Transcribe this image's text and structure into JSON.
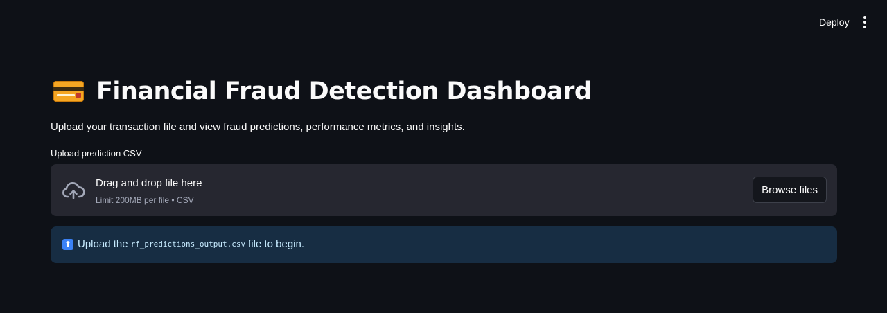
{
  "header": {
    "deploy_label": "Deploy",
    "menu_icon": "more-vertical-icon"
  },
  "page": {
    "title_icon": "credit-card-icon",
    "title": "Financial Fraud Detection Dashboard",
    "subtitle": "Upload your transaction file and view fraud predictions, performance metrics, and insights."
  },
  "uploader": {
    "label": "Upload prediction CSV",
    "icon": "cloud-upload-icon",
    "drop_text": "Drag and drop file here",
    "limit_text": "Limit 200MB per file • CSV",
    "browse_label": "Browse files"
  },
  "info": {
    "icon": "up-arrow-icon",
    "text_before": "Upload the",
    "filename": "rf_predictions_output.csv",
    "text_after": "file to begin."
  },
  "colors": {
    "background": "#0e1117",
    "dropzone": "#262730",
    "info_background": "#172d43",
    "info_text": "#c7ebff"
  }
}
